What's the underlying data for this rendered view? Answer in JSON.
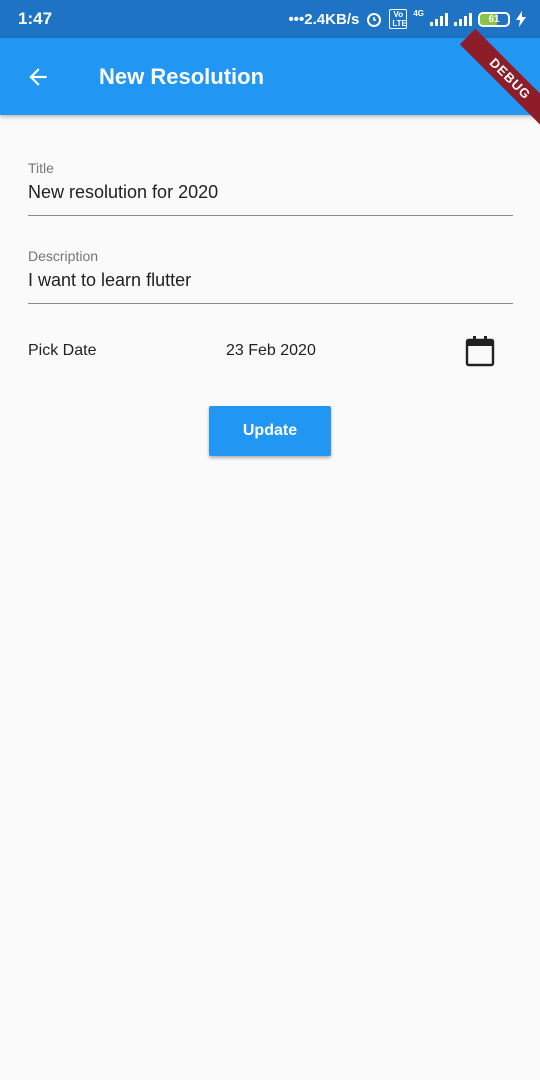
{
  "status_bar": {
    "time": "1:47",
    "net_speed": "•••2.4KB/s",
    "network_tag": "4G",
    "volte_tag": "Vo LTE",
    "battery_level": "61",
    "icons": [
      "alarm-icon",
      "volte-icon",
      "signal-icon",
      "signal-icon",
      "battery-icon",
      "charging-icon"
    ]
  },
  "debug_banner": "DEBUG",
  "app_bar": {
    "title": "New Resolution",
    "back_icon": "arrow-back-icon",
    "background": "#2196f3"
  },
  "form": {
    "title_field": {
      "label": "Title",
      "value": "New resolution for 2020"
    },
    "description_field": {
      "label": "Description",
      "value": "I want to learn flutter"
    },
    "date_row": {
      "label": "Pick Date",
      "value": "23 Feb 2020",
      "icon": "calendar-icon"
    },
    "update_label": "Update"
  }
}
